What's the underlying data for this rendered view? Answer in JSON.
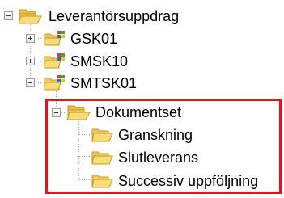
{
  "tree": {
    "root": {
      "label": "Leverantörsuppdrag",
      "expanded": true,
      "icon": "folder-open-icon"
    },
    "items": [
      {
        "label": "GSK01",
        "expanded": false,
        "icon": "folder-star-icon"
      },
      {
        "label": "SMSK10",
        "expanded": false,
        "icon": "folder-star-icon"
      },
      {
        "label": "SMTSK01",
        "expanded": true,
        "icon": "folder-star-icon"
      }
    ],
    "subfolder": {
      "label": "Dokumentset",
      "expanded": true,
      "icon": "folder-open-icon",
      "children": [
        {
          "label": "Granskning",
          "icon": "folder-icon"
        },
        {
          "label": "Slutleverans",
          "icon": "folder-icon"
        },
        {
          "label": "Successiv uppföljning",
          "icon": "folder-icon"
        }
      ]
    }
  },
  "colors": {
    "highlight_border": "#e8101f",
    "folder_yellow": "#f5d36c",
    "folder_edge": "#c49a1f",
    "tree_line": "#a0a0a0",
    "badge_red": "#e23b2e",
    "badge_blue": "#1c73d1",
    "badge_green": "#34a83a",
    "badge_yellow": "#f2c21a"
  }
}
